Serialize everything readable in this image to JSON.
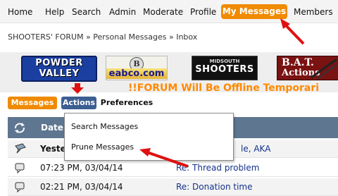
{
  "topnav": {
    "items": [
      "Home",
      "Help",
      "Search",
      "Admin",
      "Moderate",
      "Profile",
      "My Messages",
      "Members"
    ]
  },
  "breadcrumb": "SHOOTERS' FORUM » Personal Messages » Inbox",
  "banners": {
    "powder_valley": [
      "POWDER",
      "VALLEY"
    ],
    "eabco": "eabco.com",
    "midsouth": [
      "MIDSOUTH",
      "SHOOTERS"
    ],
    "bat": [
      "B.A.T.",
      "Actions"
    ]
  },
  "announcement": "!!FORUM Will Be Offline Temporari",
  "tabs": {
    "messages": "Messages",
    "actions": "Actions",
    "preferences": "Preferences"
  },
  "table": {
    "date_header": "Date",
    "rows": [
      {
        "date": "Yeste",
        "subject": "le, AKA",
        "icon": "message-read-icon"
      },
      {
        "date": "07:23 PM, 03/04/14",
        "subject": "Re: Thread problem",
        "icon": "message-icon"
      },
      {
        "date": "02:21 PM, 03/04/14",
        "subject": "Re: Donation time",
        "icon": "message-icon"
      }
    ]
  },
  "actions_menu": {
    "items": [
      "Search Messages",
      "Prune Messages"
    ]
  },
  "colors": {
    "accent_orange": "#f08a00",
    "header_bar": "#5f7690",
    "active_tab_blue": "#3c5e92",
    "arrow_red": "#e01010"
  }
}
